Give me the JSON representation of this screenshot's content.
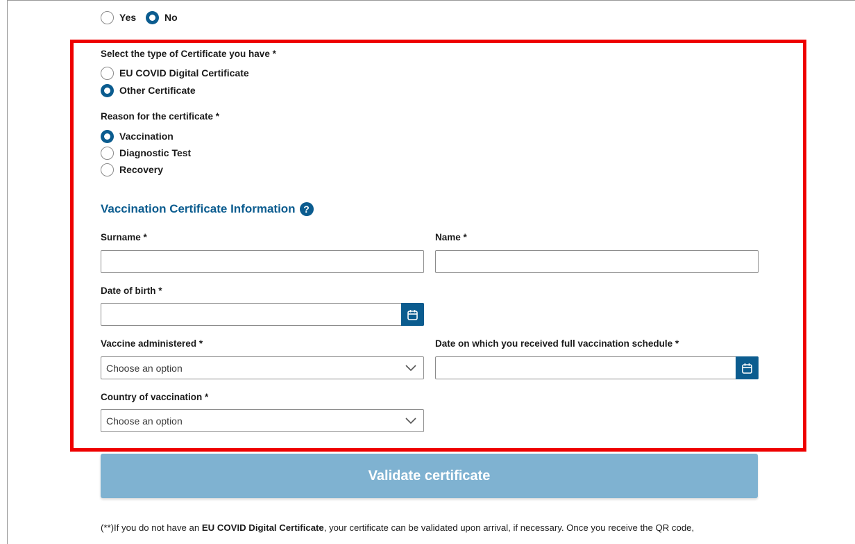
{
  "top_question": {
    "options": [
      {
        "label": "Yes",
        "checked": false
      },
      {
        "label": "No",
        "checked": true
      }
    ]
  },
  "certificate_type": {
    "label": "Select the type of Certificate you have *",
    "options": [
      {
        "label": "EU COVID Digital Certificate",
        "checked": false
      },
      {
        "label": "Other Certificate",
        "checked": true
      }
    ]
  },
  "reason": {
    "label": "Reason for the certificate *",
    "options": [
      {
        "label": "Vaccination",
        "checked": true
      },
      {
        "label": "Diagnostic Test",
        "checked": false
      },
      {
        "label": "Recovery",
        "checked": false
      }
    ]
  },
  "section": {
    "title": "Vaccination Certificate Information",
    "help_glyph": "?"
  },
  "fields": {
    "surname_label": "Surname *",
    "surname_value": "",
    "name_label": "Name *",
    "name_value": "",
    "dob_label": "Date of birth *",
    "dob_value": "",
    "vaccine_label": "Vaccine administered *",
    "vaccine_value": "Choose an option",
    "full_schedule_label": "Date on which you received full vaccination schedule *",
    "full_schedule_value": "",
    "country_label": "Country of vaccination *",
    "country_value": "Choose an option"
  },
  "validate_button": "Validate certificate",
  "footnote": {
    "prefix": "(**)If you do not have an ",
    "bold": "EU COVID Digital Certificate",
    "suffix": ", your certificate can be validated upon arrival, if necessary. Once you receive the QR code,"
  },
  "colors": {
    "accent": "#0b5c8f",
    "highlight_border": "#ee0000",
    "button_disabled": "#7fb2d1"
  }
}
